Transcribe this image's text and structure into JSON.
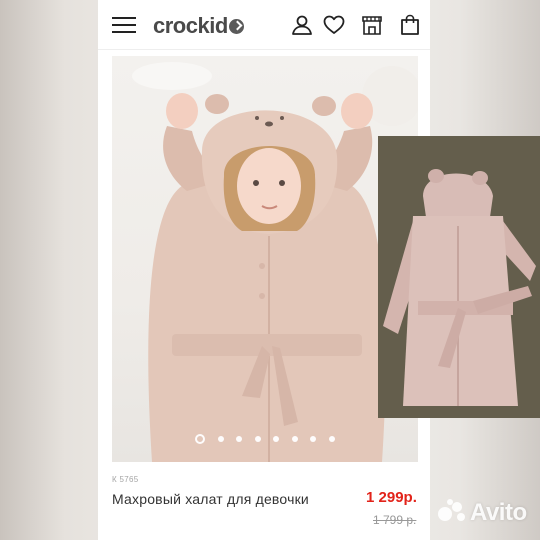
{
  "brand": {
    "logo_text": "crockid"
  },
  "header_icons": [
    "menu-icon",
    "user-icon",
    "heart-icon",
    "store-icon",
    "shopping-bag-icon"
  ],
  "product": {
    "sku": "К 5765",
    "title": "Махровый халат для девочки",
    "price": "1 299р.",
    "old_price": "1 799 р."
  },
  "gallery": {
    "slide_count": 8,
    "active_index": 0
  },
  "watermark": {
    "text": "Avito"
  },
  "colors": {
    "accent_price": "#e2231a",
    "robe_pink": "#e3c7b9",
    "photo_background": "#5f5a48"
  }
}
